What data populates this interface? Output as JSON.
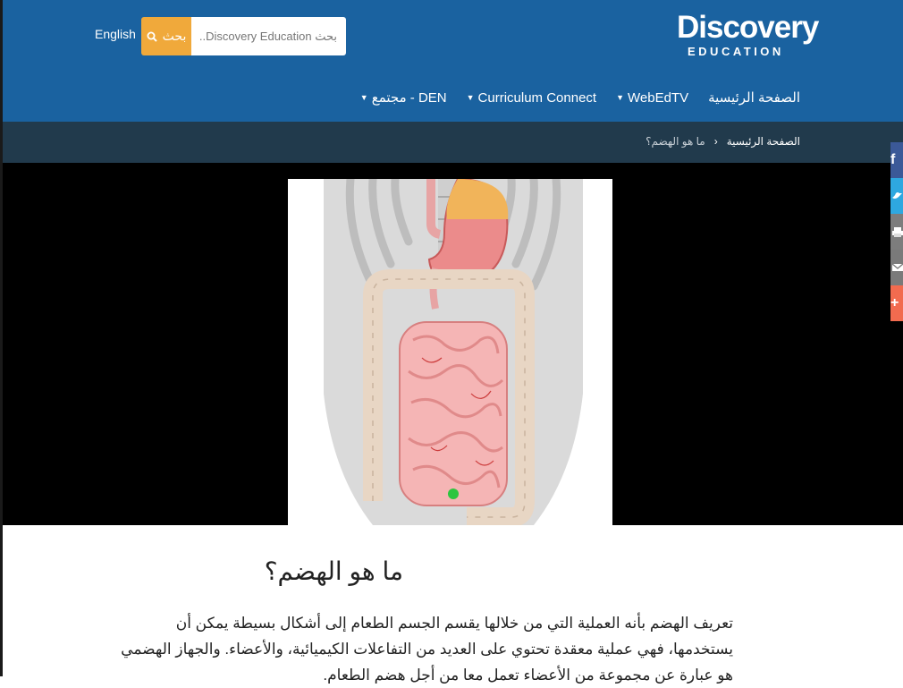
{
  "header": {
    "language_link": "English",
    "search": {
      "button_label": "بحث",
      "placeholder": "بحث Discovery Education..."
    },
    "logo": {
      "word": "Discovery",
      "sub": "EDUCATION"
    }
  },
  "nav": {
    "items": [
      {
        "label": "الصفحة الرئيسية",
        "dropdown": false
      },
      {
        "label": "WebEdTV",
        "dropdown": true
      },
      {
        "label": "Curriculum Connect",
        "dropdown": true
      },
      {
        "label": "مجتمع - DEN",
        "dropdown": true
      }
    ]
  },
  "breadcrumb": {
    "home": "الصفحة الرئيسية",
    "separator": "›",
    "current": "ما هو الهضم؟"
  },
  "social": [
    "facebook-icon",
    "twitter-icon",
    "print-icon",
    "email-icon",
    "share-plus-icon"
  ],
  "article": {
    "title": "ما هو الهضم؟",
    "body": "تعريف الهضم بأنه العملية التي من خلالها يقسم الجسم الطعام إلى أشكال بسيطة يمكن أن يستخدمها، فهي عملية معقدة تحتوي على العديد من التفاعلات الكيميائية، والأعضاء. والجهاز الهضمي هو عبارة عن مجموعة من الأعضاء تعمل معا من أجل هضم الطعام."
  },
  "colors": {
    "header_blue": "#1a62a0",
    "breadcrumb_bar": "#213a4c",
    "search_button": "#f0a93b",
    "facebook": "#3b5998",
    "twitter": "#2ea8e0",
    "share": "#f26b4f"
  }
}
